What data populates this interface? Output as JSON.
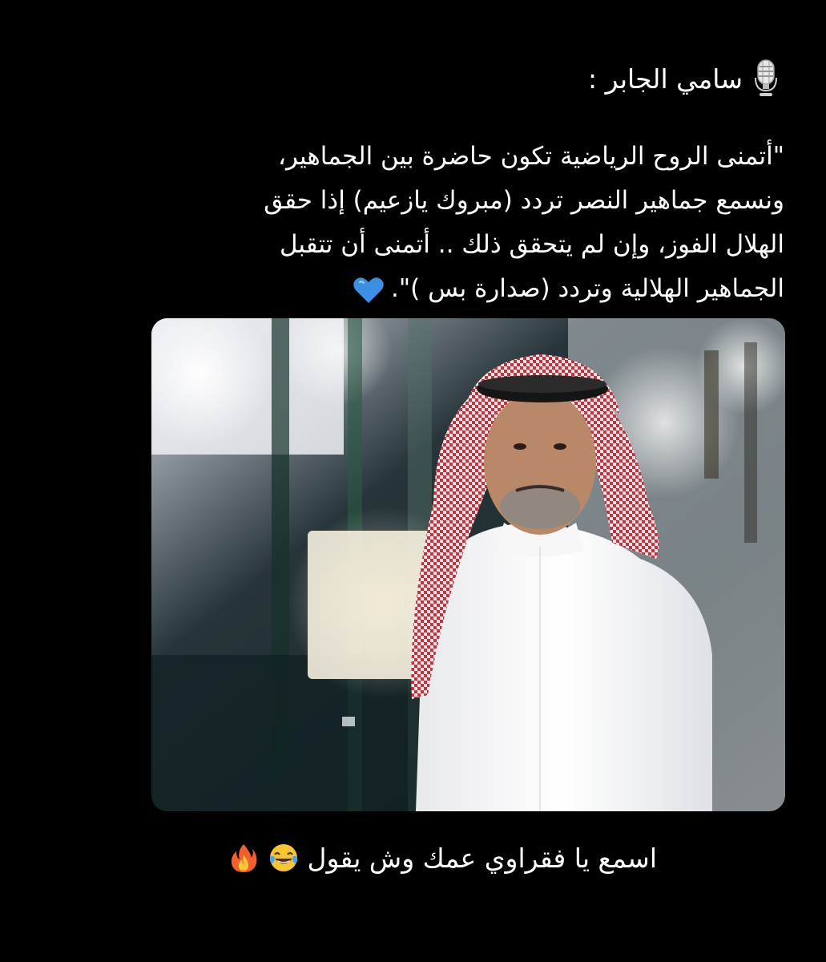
{
  "post": {
    "speaker": "سامي الجابر :",
    "speaker_icon": "microphone-icon",
    "quote_lines": [
      "\"أتمنى الروح الرياضية تكون حاضرة بين الجماهير،",
      "ونسمع جماهير النصر تردد (مبروك يازعيم) إذا حقق",
      "الهلال الفوز، وإن لم يتحقق ذلك .. أتمنى أن تتقبل",
      "الجماهير الهلالية وتردد (صدارة بس )\"."
    ],
    "quote_end_icon": "blue-heart-icon",
    "photo": {
      "subject": "man-in-shemagh-photo"
    },
    "caption": "اسمع يا فقراوي عمك وش يقول",
    "caption_icons": [
      "laughing-tears-icon",
      "fire-icon"
    ]
  },
  "colors": {
    "background": "#000000",
    "text": "#ffffff",
    "heart": "#3d8fe6",
    "shemagh_red": "#c8323f"
  }
}
